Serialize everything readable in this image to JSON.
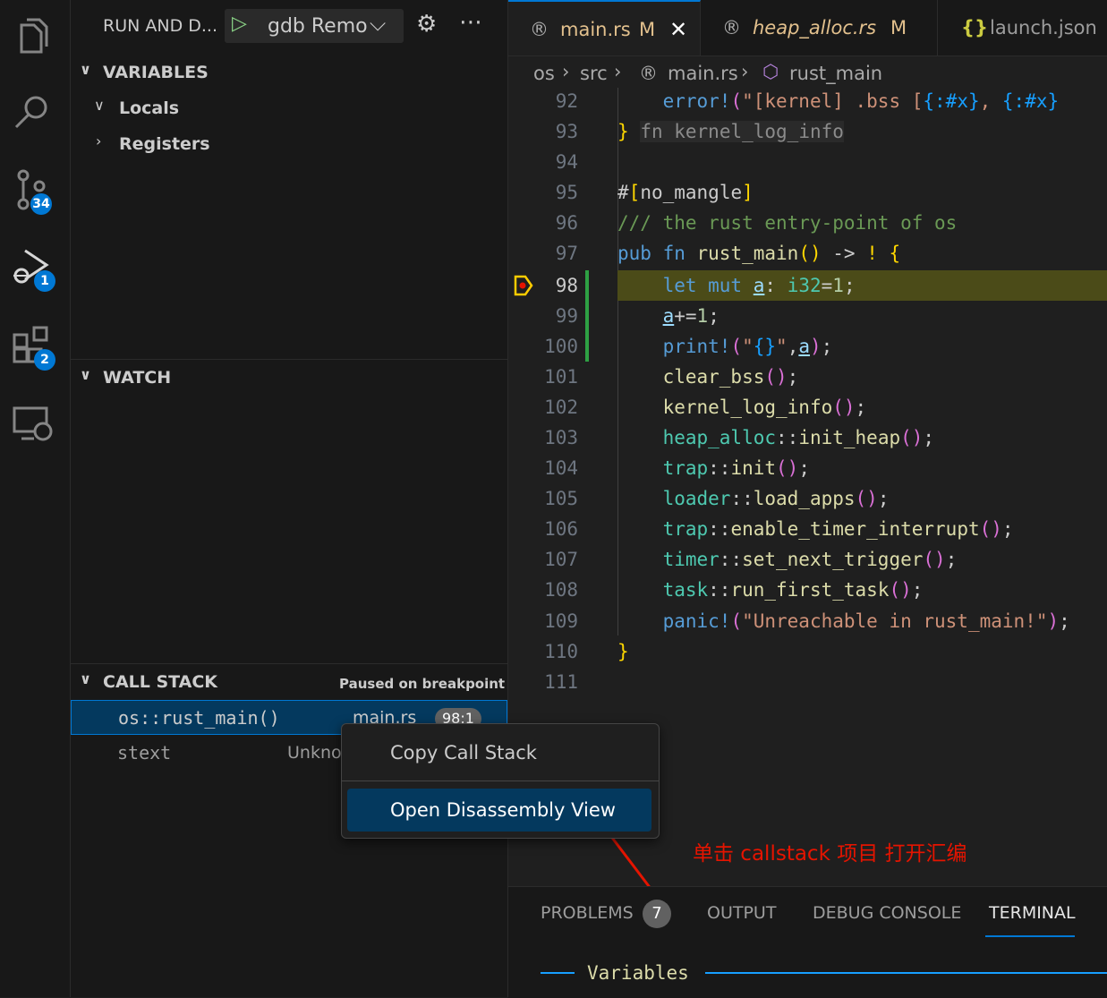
{
  "activity_bar": {
    "items": [
      {
        "name": "explorer-icon"
      },
      {
        "name": "search-icon"
      },
      {
        "name": "source-control-icon",
        "badge": "34"
      },
      {
        "name": "run-debug-icon",
        "badge": "1"
      },
      {
        "name": "extensions-icon",
        "badge": "2"
      },
      {
        "name": "remote-explorer-icon"
      }
    ]
  },
  "sidebar": {
    "title": "RUN AND D...",
    "launch_config": "gdb Remo",
    "variables": {
      "header": "VARIABLES",
      "items": [
        "Locals",
        "Registers"
      ]
    },
    "watch": {
      "header": "WATCH"
    },
    "call_stack": {
      "header": "CALL STACK",
      "status": "Paused on breakpoint",
      "frames": [
        {
          "name": "os::rust_main()",
          "file": "main.rs",
          "position": "98:1"
        },
        {
          "name": "stext",
          "file": "Unkno"
        }
      ]
    }
  },
  "tabs": [
    {
      "label": "main.rs",
      "modified": "M",
      "icon": "rust-icon"
    },
    {
      "label": "heap_alloc.rs",
      "modified": "M",
      "icon": "rust-icon"
    },
    {
      "label": "launch.json",
      "icon": "json-icon"
    }
  ],
  "breadcrumb": [
    "os",
    "src",
    "main.rs",
    "rust_main"
  ],
  "code": {
    "line_numbers": [
      "92",
      "93",
      "94",
      "95",
      "96",
      "97",
      "98",
      "99",
      "100",
      "101",
      "102",
      "103",
      "104",
      "105",
      "106",
      "107",
      "108",
      "109",
      "110",
      "111"
    ],
    "current_line": "98"
  },
  "context_menu": {
    "items": [
      "Copy Call Stack",
      "Open Disassembly View"
    ]
  },
  "annotation": "单击 callstack 项目 打开汇编",
  "panel": {
    "tabs": [
      "PROBLEMS",
      "OUTPUT",
      "DEBUG CONSOLE",
      "TERMINAL"
    ],
    "problems_count": "7",
    "terminal_heading": "Variables"
  },
  "colors": {
    "accent": "#0078d4",
    "selection": "#04395e",
    "annotation": "#e51400",
    "breakpoint_line": "#4b4b18"
  }
}
